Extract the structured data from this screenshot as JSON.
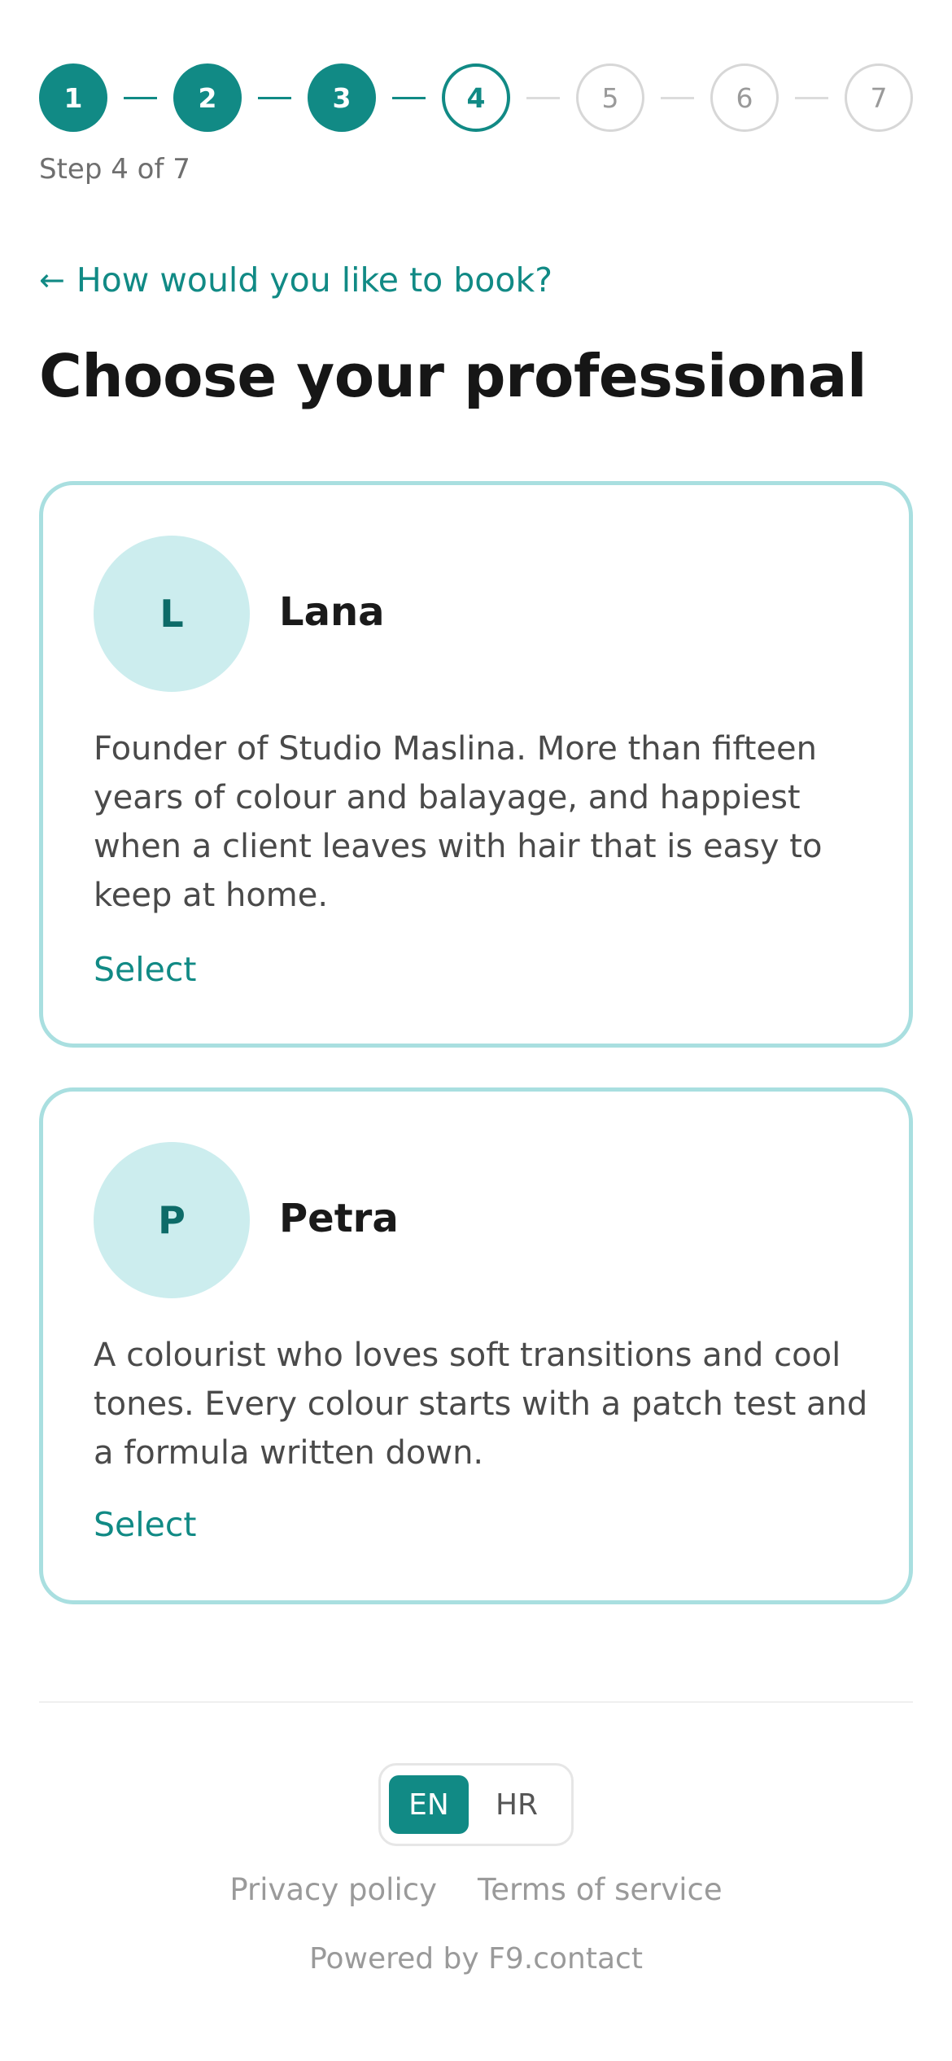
{
  "stepper": {
    "steps": [
      {
        "label": "1",
        "state": "done"
      },
      {
        "label": "2",
        "state": "done"
      },
      {
        "label": "3",
        "state": "done"
      },
      {
        "label": "4",
        "state": "current"
      },
      {
        "label": "5",
        "state": "todo"
      },
      {
        "label": "6",
        "state": "todo"
      },
      {
        "label": "7",
        "state": "todo"
      }
    ],
    "caption": "Step 4 of 7"
  },
  "back_link": {
    "arrow": "←",
    "label": "How would you like to book?"
  },
  "page_title": "Choose your professional",
  "professionals": [
    {
      "initial": "L",
      "name": "Lana",
      "bio": "Founder of Studio Maslina. More than fifteen years of colour and balayage, and happiest when a client leaves with hair that is easy to keep at home.",
      "select_label": "Select"
    },
    {
      "initial": "P",
      "name": "Petra",
      "bio": "A colourist who loves soft transitions and cool tones. Every colour starts with a patch test and a formula written down.",
      "select_label": "Select"
    }
  ],
  "language": {
    "options": [
      "EN",
      "HR"
    ],
    "selected": "EN"
  },
  "footer": {
    "privacy": "Privacy policy",
    "terms": "Terms of service",
    "powered_by": "Powered by F9.contact"
  },
  "colors": {
    "accent": "#118a85",
    "card_border": "#a9dfe0",
    "avatar_bg": "#ccedee"
  }
}
